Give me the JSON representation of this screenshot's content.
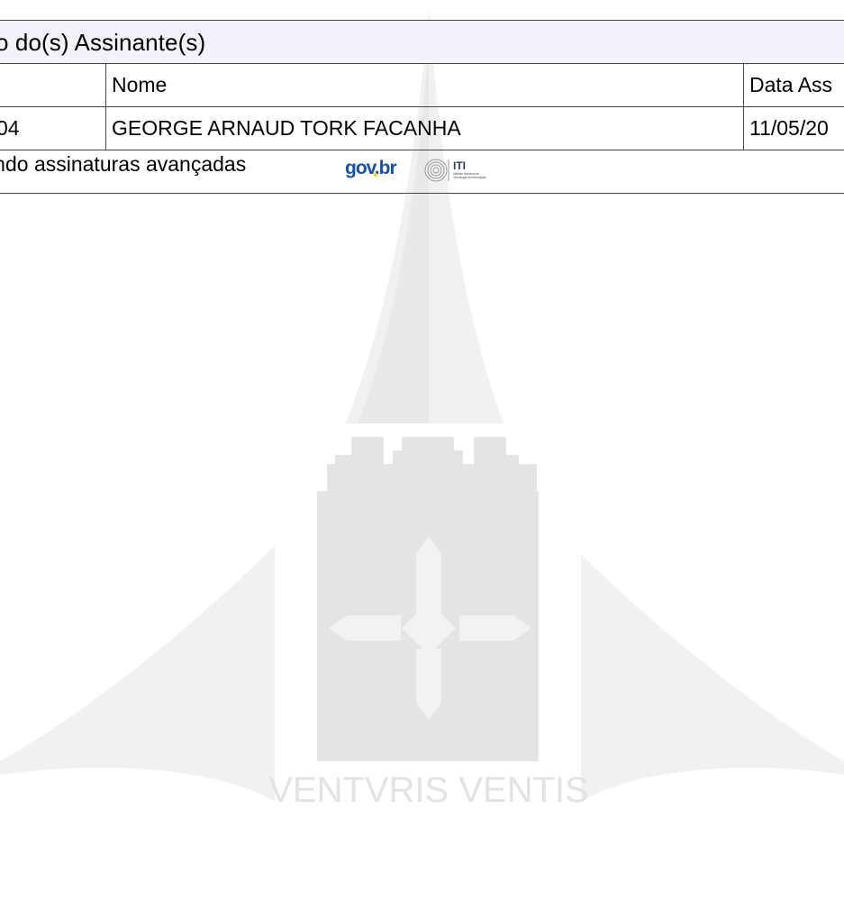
{
  "section": {
    "title": "o do(s) Assinante(s)"
  },
  "table": {
    "columns": [
      "",
      "Nome",
      "Data Ass"
    ],
    "rows": [
      [
        "04",
        "GEORGE ARNAUD TORK FACANHA",
        "11/05/20"
      ]
    ]
  },
  "footer": {
    "text": "tando assinaturas avançadas",
    "logos": [
      {
        "name": "gov.br",
        "text": "gov.br"
      },
      {
        "name": "ITI",
        "text": "ITI",
        "subtext_line1": "Instituto Nacional de",
        "subtext_line2": "Tecnologia da Informação"
      }
    ]
  },
  "watermark": {
    "motto": "VENTVRIS VENTIS"
  },
  "colors": {
    "header_bg": "#f2f3fa",
    "border": "#444444",
    "govbr_blue": "#1351b4",
    "govbr_yellow": "#ffcd07",
    "govbr_green": "#168821",
    "watermark_gray": "#e6e6e6"
  }
}
